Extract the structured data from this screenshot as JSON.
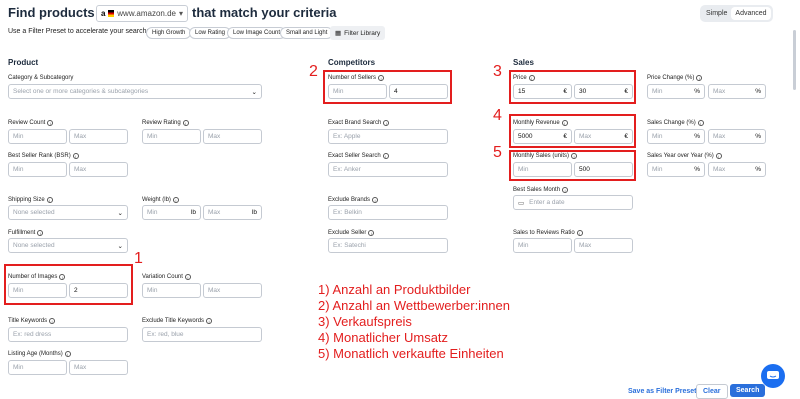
{
  "header": {
    "title_prefix": "Find products on",
    "marketplace": "www.amazon.de",
    "title_suffix": "that match your criteria",
    "mode_simple": "Simple",
    "mode_advanced": "Advanced"
  },
  "presets": {
    "label": "Use a Filter Preset to accelerate your search:",
    "chips": [
      "High Growth",
      "Low Rating",
      "Low Image Count",
      "Small and Light"
    ],
    "library": "Filter Library"
  },
  "product": {
    "heading": "Product",
    "category_label": "Category & Subcategory",
    "category_placeholder": "Select one or more categories & subcategories",
    "review_count": "Review Count",
    "review_rating": "Review Rating",
    "bsr": "Best Seller Rank (BSR)",
    "shipping_size": "Shipping Size",
    "shipping_placeholder": "None selected",
    "weight": "Weight (lb)",
    "fulfillment": "Fulfillment",
    "fulfillment_placeholder": "None selected",
    "num_images": "Number of Images",
    "num_images_min": "Min",
    "num_images_max": "2",
    "variation_count": "Variation Count",
    "title_keywords": "Title Keywords",
    "title_keywords_placeholder": "Ex: red dress",
    "exclude_title_keywords": "Exclude Title Keywords",
    "exclude_title_placeholder": "Ex: red, blue",
    "listing_age": "Listing Age (Months)",
    "unit_lb": "lb"
  },
  "competitors": {
    "heading": "Competitors",
    "num_sellers": "Number of Sellers",
    "num_sellers_max": "4",
    "exact_brand": "Exact Brand Search",
    "exact_brand_placeholder": "Ex: Apple",
    "exact_seller": "Exact Seller Search",
    "exact_seller_placeholder": "Ex: Anker",
    "exclude_brands": "Exclude Brands",
    "exclude_brands_placeholder": "Ex: Belkin",
    "exclude_seller": "Exclude Seller",
    "exclude_seller_placeholder": "Ex: Satechi"
  },
  "sales": {
    "heading": "Sales",
    "price": "Price",
    "price_min": "15",
    "price_max": "30",
    "price_change": "Price Change (%)",
    "monthly_revenue": "Monthly Revenue",
    "monthly_revenue_min": "5000",
    "sales_change": "Sales Change (%)",
    "monthly_sales": "Monthly Sales (units)",
    "monthly_sales_max": "500",
    "sales_yoy": "Sales Year over Year (%)",
    "best_month": "Best Sales Month",
    "best_month_placeholder": "Enter a date",
    "sales_to_reviews": "Sales to Reviews Ratio",
    "unit_eur": "€",
    "unit_pct": "%"
  },
  "common": {
    "min": "Min",
    "max": "Max"
  },
  "annotations": {
    "n1": "1",
    "n2": "2",
    "n3": "3",
    "n4": "4",
    "n5": "5",
    "notes": [
      "1) Anzahl an Produktbilder",
      "2) Anzahl an Wettbewerber:innen",
      "3) Verkaufspreis",
      "4) Monatlicher Umsatz",
      "5) Monatlich verkaufte Einheiten"
    ]
  },
  "footer": {
    "save_preset": "Save as Filter Preset",
    "clear": "Clear",
    "search": "Search"
  },
  "colors": {
    "accent": "#2a6fdb",
    "annotation_red": "#e31e1e"
  }
}
